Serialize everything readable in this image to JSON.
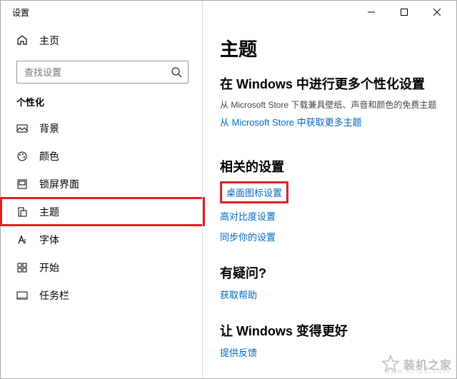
{
  "window": {
    "title": "设置"
  },
  "home": {
    "label": "主页"
  },
  "search": {
    "placeholder": "查找设置"
  },
  "category": {
    "label": "个性化"
  },
  "sidebar": {
    "items": [
      {
        "label": "背景",
        "icon": "picture-icon"
      },
      {
        "label": "颜色",
        "icon": "palette-icon"
      },
      {
        "label": "锁屏界面",
        "icon": "lock-screen-icon"
      },
      {
        "label": "主题",
        "icon": "theme-icon",
        "selected": true
      },
      {
        "label": "字体",
        "icon": "font-icon"
      },
      {
        "label": "开始",
        "icon": "start-icon"
      },
      {
        "label": "任务栏",
        "icon": "taskbar-icon"
      }
    ]
  },
  "main": {
    "title": "主题",
    "personalize": {
      "heading": "在 Windows 中进行更多个性化设置",
      "sub": "从 Microsoft Store 下载兼具壁纸、声音和颜色的免费主题",
      "link": "从 Microsoft Store 中获取更多主题"
    },
    "related": {
      "heading": "相关的设置",
      "links": [
        "桌面图标设置",
        "高对比度设置",
        "同步你的设置"
      ]
    },
    "feedback": {
      "heading": "有疑问?",
      "link": "获取帮助"
    },
    "better": {
      "heading": "让 Windows 变得更好",
      "link": "提供反馈"
    }
  },
  "watermark": {
    "text": "装机之家",
    "url": "www.lotpc.com"
  }
}
